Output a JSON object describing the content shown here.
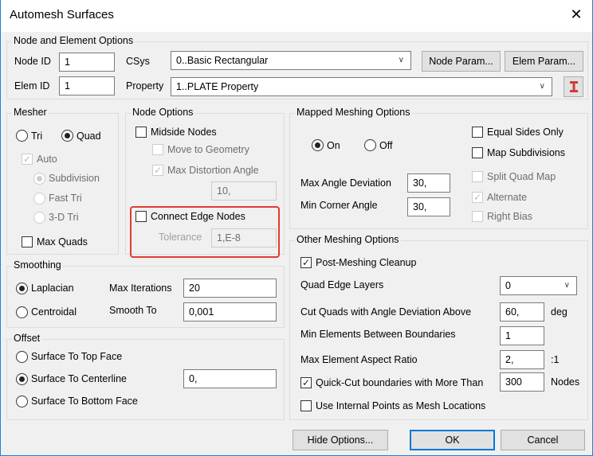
{
  "window": {
    "title": "Automesh Surfaces",
    "close": "✕"
  },
  "node_elem": {
    "legend": "Node and Element Options",
    "node_id_label": "Node ID",
    "node_id": "1",
    "elem_id_label": "Elem ID",
    "elem_id": "1",
    "csys_label": "CSys",
    "csys": "0..Basic Rectangular",
    "property_label": "Property",
    "property": "1..PLATE Property",
    "node_param": "Node Param...",
    "elem_param": "Elem Param...",
    "property_icon_color": "#d03a3a"
  },
  "mesher": {
    "legend": "Mesher",
    "tri": "Tri",
    "quad": "Quad",
    "auto": "Auto",
    "subdivision": "Subdivision",
    "fast_tri": "Fast Tri",
    "tri3d": "3-D Tri",
    "max_quads": "Max Quads",
    "selected": "Quad"
  },
  "node_options": {
    "legend": "Node Options",
    "midside": "Midside Nodes",
    "move_geom": "Move to Geometry",
    "max_distortion": "Max Distortion Angle",
    "max_distortion_value": "10,",
    "connect_edge": "Connect Edge Nodes",
    "tolerance_label": "Tolerance",
    "tolerance": "1,E-8",
    "highlight_color": "#e03c31"
  },
  "mapped": {
    "legend": "Mapped Meshing Options",
    "on": "On",
    "off": "Off",
    "selected": "On",
    "equal_sides": "Equal Sides Only",
    "map_subdiv": "Map Subdivisions",
    "split_quad": "Split Quad Map",
    "alternate": "Alternate",
    "right_bias": "Right Bias",
    "max_angle_label": "Max Angle Deviation",
    "max_angle": "30,",
    "min_corner_label": "Min Corner Angle",
    "min_corner": "30,"
  },
  "other": {
    "legend": "Other Meshing Options",
    "post_cleanup": "Post-Meshing Cleanup",
    "quad_edge_label": "Quad Edge Layers",
    "quad_edge": "0",
    "cut_quads_label": "Cut Quads with Angle Deviation Above",
    "cut_quads": "60,",
    "cut_quads_unit": "deg",
    "min_elem_label": "Min Elements Between Boundaries",
    "min_elem": "1",
    "aspect_label": "Max Element Aspect Ratio",
    "aspect": "2,",
    "aspect_unit": ":1",
    "quickcut_label": "Quick-Cut boundaries with More Than",
    "quickcut": "300",
    "quickcut_unit": "Nodes",
    "internal_pts": "Use Internal Points as Mesh Locations"
  },
  "smoothing": {
    "legend": "Smoothing",
    "laplacian": "Laplacian",
    "centroidal": "Centroidal",
    "selected": "Laplacian",
    "max_iter_label": "Max Iterations",
    "max_iter": "20",
    "smooth_to_label": "Smooth To",
    "smooth_to": "0,001"
  },
  "offset": {
    "legend": "Offset",
    "top": "Surface To Top Face",
    "center": "Surface To Centerline",
    "bottom": "Surface To Bottom Face",
    "selected": "Surface To Centerline",
    "value": "0,"
  },
  "buttons": {
    "hide": "Hide Options...",
    "ok": "OK",
    "cancel": "Cancel"
  }
}
